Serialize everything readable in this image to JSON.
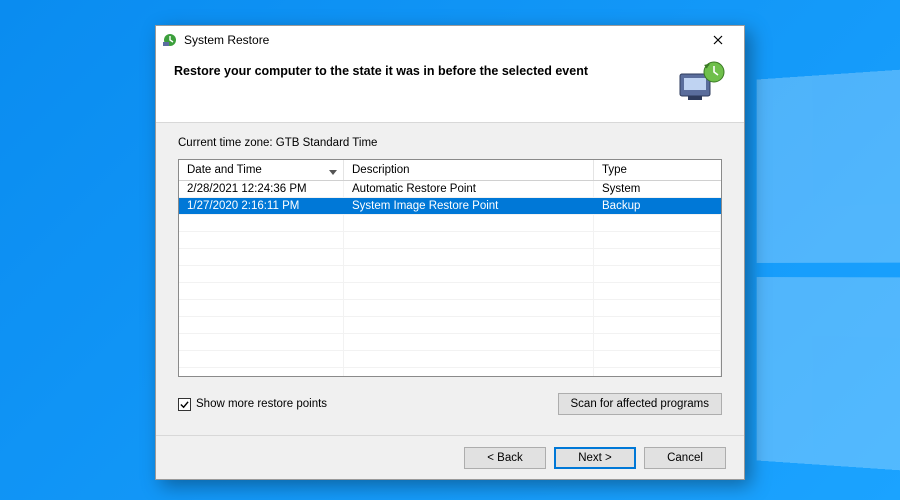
{
  "window": {
    "title": "System Restore"
  },
  "header": {
    "text": "Restore your computer to the state it was in before the selected event"
  },
  "timezone_label": "Current time zone: GTB Standard Time",
  "columns": {
    "date": "Date and Time",
    "desc": "Description",
    "type": "Type"
  },
  "rows": [
    {
      "date": "2/28/2021 12:24:36 PM",
      "desc": "Automatic Restore Point",
      "type": "System",
      "selected": false
    },
    {
      "date": "1/27/2020 2:16:11 PM",
      "desc": "System Image Restore Point",
      "type": "Backup",
      "selected": true
    }
  ],
  "checkbox": {
    "label": "Show more restore points",
    "checked": true
  },
  "buttons": {
    "scan": "Scan for affected programs",
    "back": "< Back",
    "next": "Next >",
    "cancel": "Cancel"
  }
}
